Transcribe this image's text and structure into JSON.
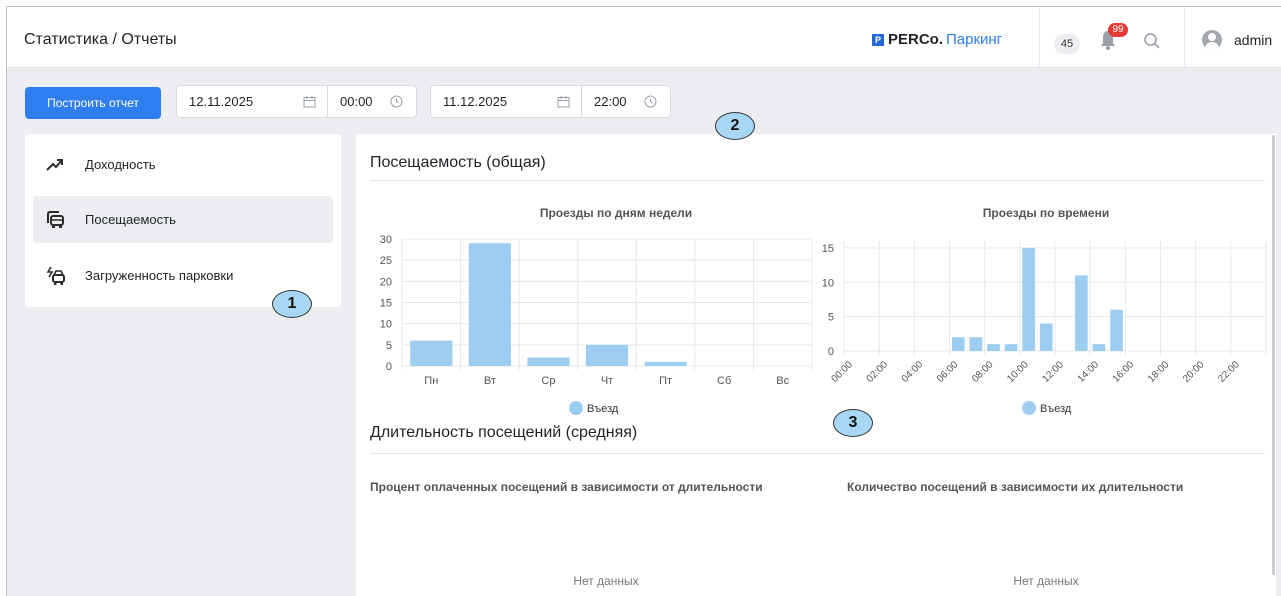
{
  "header": {
    "title": "Статистика / Отчеты",
    "brand_prefix": "PERCo.",
    "brand_product": "Паркинг",
    "logo_letter": "P",
    "counter": "45",
    "notifications": "99",
    "user": "admin"
  },
  "toolbar": {
    "build_label": "Построить отчет",
    "date_from": "12.11.2025",
    "time_from": "00:00",
    "date_to": "11.12.2025",
    "time_to": "22:00"
  },
  "sidebar": {
    "items": [
      {
        "label": "Доходность",
        "icon": "trend-up-icon",
        "active": false
      },
      {
        "label": "Посещаемость",
        "icon": "car-front-icon",
        "active": true
      },
      {
        "label": "Загруженность парковки",
        "icon": "car-load-icon",
        "active": false
      }
    ]
  },
  "callouts": [
    "1",
    "2",
    "3"
  ],
  "main": {
    "attendance_title": "Посещаемость (общая)",
    "duration_title": "Длительность посещений (средняя)",
    "paid_percent_title": "Процент оплаченных посещений в зависимости от длительности",
    "count_by_duration_title": "Количество посещений в зависимости их длительности",
    "no_data_left": "Нет данных",
    "no_data_right": "Нет данных"
  },
  "colors": {
    "accent": "#2f7ef0",
    "bar": "#9ecdf2",
    "badge": "#e53935"
  },
  "chart_data": [
    {
      "type": "bar",
      "title": "Проезды по дням недели",
      "categories": [
        "Пн",
        "Вт",
        "Ср",
        "Чт",
        "Пт",
        "Сб",
        "Вс"
      ],
      "series": [
        {
          "name": "Въезд",
          "values": [
            6,
            29,
            2,
            5,
            1,
            0,
            0
          ]
        }
      ],
      "yticks": [
        0,
        5,
        10,
        15,
        20,
        25,
        30
      ],
      "ylim": [
        0,
        30
      ],
      "legend": "bottom",
      "grid": true
    },
    {
      "type": "bar",
      "title": "Проезды по времени",
      "categories": [
        "00:00",
        "01:00",
        "02:00",
        "03:00",
        "04:00",
        "05:00",
        "06:00",
        "07:00",
        "08:00",
        "09:00",
        "10:00",
        "11:00",
        "12:00",
        "13:00",
        "14:00",
        "15:00",
        "16:00",
        "17:00",
        "18:00",
        "19:00",
        "20:00",
        "21:00",
        "22:00",
        "23:00"
      ],
      "tick_labels": [
        "00:00",
        "02:00",
        "04:00",
        "06:00",
        "08:00",
        "10:00",
        "12:00",
        "14:00",
        "16:00",
        "18:00",
        "20:00",
        "22:00"
      ],
      "series": [
        {
          "name": "Въезд",
          "values": [
            0,
            0,
            0,
            0,
            0,
            0,
            2,
            2,
            1,
            1,
            15,
            4,
            0,
            11,
            1,
            6,
            0,
            0,
            0,
            0,
            0,
            0,
            0,
            0
          ]
        }
      ],
      "yticks": [
        0,
        5,
        10,
        15
      ],
      "ylim": [
        0,
        16
      ],
      "legend": "bottom",
      "grid": true
    }
  ]
}
